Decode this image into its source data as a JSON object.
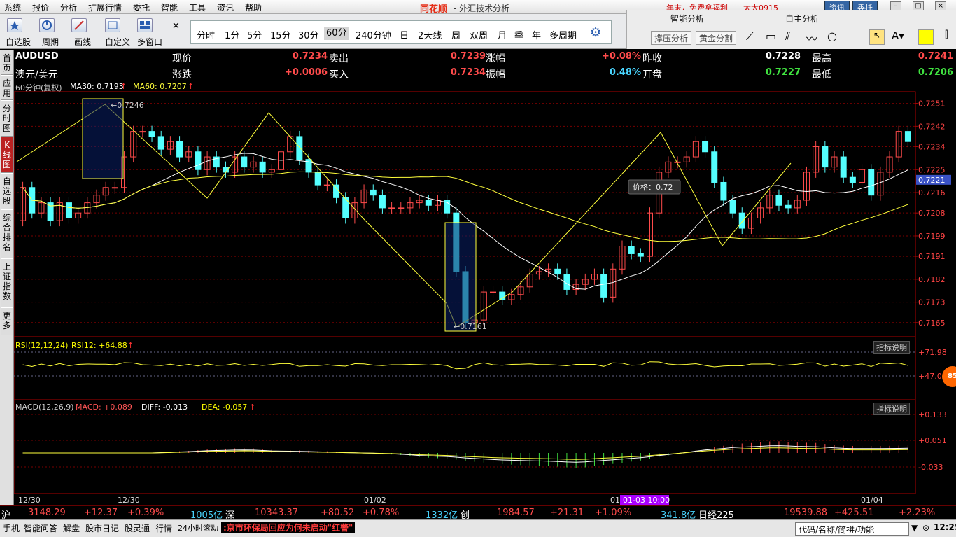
{
  "menu": [
    "系统",
    "报价",
    "分析",
    "扩展行情",
    "委托",
    "智能",
    "工具",
    "资讯",
    "帮助"
  ],
  "brand": "同花顺",
  "app_title": "- 外汇技术分析",
  "promo": "年末，免费拿福利",
  "user": "太太0915",
  "top_buttons": [
    "资讯",
    "委托"
  ],
  "toolbar": {
    "items": [
      "自选股",
      "周期",
      "画线",
      "自定义",
      "多窗口"
    ]
  },
  "periods": [
    "分时",
    "1分",
    "5分",
    "15分",
    "30分",
    "60分",
    "240分钟",
    "日",
    "2天线",
    "周",
    "双周",
    "月",
    "季",
    "年",
    "多周期"
  ],
  "active_period": "60分",
  "analysis": {
    "tabs": [
      "智能分析",
      "自主分析"
    ],
    "buttons": [
      "撑压分析",
      "黄金分割"
    ]
  },
  "side_tabs": [
    "首页",
    "应用",
    "分时图",
    "K线图",
    "自选股",
    "综合排名",
    "上证指数",
    "更多"
  ],
  "quote": {
    "symbol": "AUDUSD",
    "name": "澳元/美元",
    "fields": [
      {
        "label": "现价",
        "value": "0.7234",
        "color": "red"
      },
      {
        "label": "卖出",
        "value": "0.7239",
        "color": "red"
      },
      {
        "label": "涨幅",
        "value": "+0.08%",
        "color": "red"
      },
      {
        "label": "昨收",
        "value": "0.7228",
        "color": "white"
      },
      {
        "label": "最高",
        "value": "0.7241",
        "color": "red"
      },
      {
        "label": "涨跌",
        "value": "+0.0006",
        "color": "red"
      },
      {
        "label": "买入",
        "value": "0.7234",
        "color": "red"
      },
      {
        "label": "振幅",
        "value": "0.48%",
        "color": "cyan"
      },
      {
        "label": "开盘",
        "value": "0.7227",
        "color": "green"
      },
      {
        "label": "最低",
        "value": "0.7206",
        "color": "green"
      }
    ]
  },
  "main_legend": {
    "period": "60分钟(复权)",
    "ma30": "MA30: 0.7193",
    "ma60": "MA60: 0.7207"
  },
  "price_axis": [
    "0.7251",
    "0.7242",
    "0.7234",
    "0.7225",
    "0.7216",
    "0.7208",
    "0.7199",
    "0.7191",
    "0.7182",
    "0.7173",
    "0.7165"
  ],
  "current_price_tag": "0.7221",
  "annotations": {
    "high": "0.7246",
    "low": "0.7161",
    "tooltip": "价格：0.72"
  },
  "rsi": {
    "legend": "RSI(12,12,24)",
    "val": "RSI12: +64.88",
    "axis": [
      "+71.98",
      "+47.04"
    ],
    "btn": "指标说明"
  },
  "macd": {
    "legend": "MACD(12,26,9)",
    "macd": "MACD: +0.089",
    "diff": "DIFF: -0.013",
    "dea": "DEA: -0.057",
    "axis": [
      "+0.133",
      "+0.051",
      "-0.033"
    ],
    "btn": "指标说明"
  },
  "dates": [
    "12/30",
    "12/30",
    "01/02",
    "01",
    "01-03 10:00",
    "01/04"
  ],
  "circle_badge": "85",
  "chart_data": {
    "type": "candlestick",
    "symbol": "AUDUSD",
    "interval": "60分钟",
    "ylim": [
      0.716,
      0.7255
    ],
    "open": [
      0.7205,
      0.7218,
      0.7208,
      0.7212,
      0.7205,
      0.7212,
      0.7206,
      0.7208,
      0.7212,
      0.7215,
      0.7218,
      0.7218,
      0.723,
      0.724,
      0.724,
      0.7238,
      0.7233,
      0.7236,
      0.723,
      0.7232,
      0.7225,
      0.723,
      0.7226,
      0.7224,
      0.723,
      0.7226,
      0.7228,
      0.7224,
      0.7225,
      0.7232,
      0.7238,
      0.7229,
      0.7224,
      0.7219,
      0.7219,
      0.7214,
      0.7206,
      0.7212,
      0.7217,
      0.7215,
      0.721,
      0.721,
      0.721,
      0.7212,
      0.7213,
      0.7211,
      0.7213,
      0.7208,
      0.7185,
      0.7165,
      0.7166,
      0.7177,
      0.7177,
      0.7174,
      0.7176,
      0.7179,
      0.7184,
      0.7185,
      0.7186,
      0.7184,
      0.7178,
      0.718,
      0.7182,
      0.7184,
      0.7175,
      0.7186,
      0.7195,
      0.7192,
      0.7191,
      0.7208,
      0.7224,
      0.7228,
      0.7228,
      0.723,
      0.7236,
      0.7232,
      0.722,
      0.7213,
      0.7208,
      0.7202,
      0.7206,
      0.721,
      0.7215,
      0.7211,
      0.721,
      0.7213,
      0.7224,
      0.7234,
      0.7226,
      0.723,
      0.7222,
      0.722,
      0.7225,
      0.7215,
      0.7224,
      0.723,
      0.724
    ],
    "close": [
      0.7218,
      0.7208,
      0.7212,
      0.7205,
      0.7212,
      0.7206,
      0.7208,
      0.7212,
      0.7215,
      0.7218,
      0.7218,
      0.723,
      0.724,
      0.724,
      0.7238,
      0.7233,
      0.7236,
      0.723,
      0.7232,
      0.7225,
      0.723,
      0.7226,
      0.7224,
      0.723,
      0.7226,
      0.7228,
      0.7224,
      0.7225,
      0.7232,
      0.7238,
      0.7229,
      0.7224,
      0.7219,
      0.7219,
      0.7214,
      0.7206,
      0.7212,
      0.7217,
      0.7215,
      0.721,
      0.721,
      0.721,
      0.7212,
      0.7213,
      0.7211,
      0.7213,
      0.7208,
      0.7185,
      0.7165,
      0.7166,
      0.7177,
      0.7177,
      0.7174,
      0.7176,
      0.7179,
      0.7184,
      0.7185,
      0.7186,
      0.7184,
      0.7178,
      0.718,
      0.7182,
      0.7184,
      0.7175,
      0.7186,
      0.7195,
      0.7192,
      0.7191,
      0.7208,
      0.7224,
      0.7228,
      0.7228,
      0.723,
      0.7236,
      0.7232,
      0.722,
      0.7213,
      0.7208,
      0.7202,
      0.7206,
      0.721,
      0.7215,
      0.7211,
      0.721,
      0.7213,
      0.7224,
      0.7234,
      0.7226,
      0.723,
      0.7222,
      0.722,
      0.7225,
      0.7215,
      0.7224,
      0.723,
      0.724,
      0.7236
    ]
  }
}
